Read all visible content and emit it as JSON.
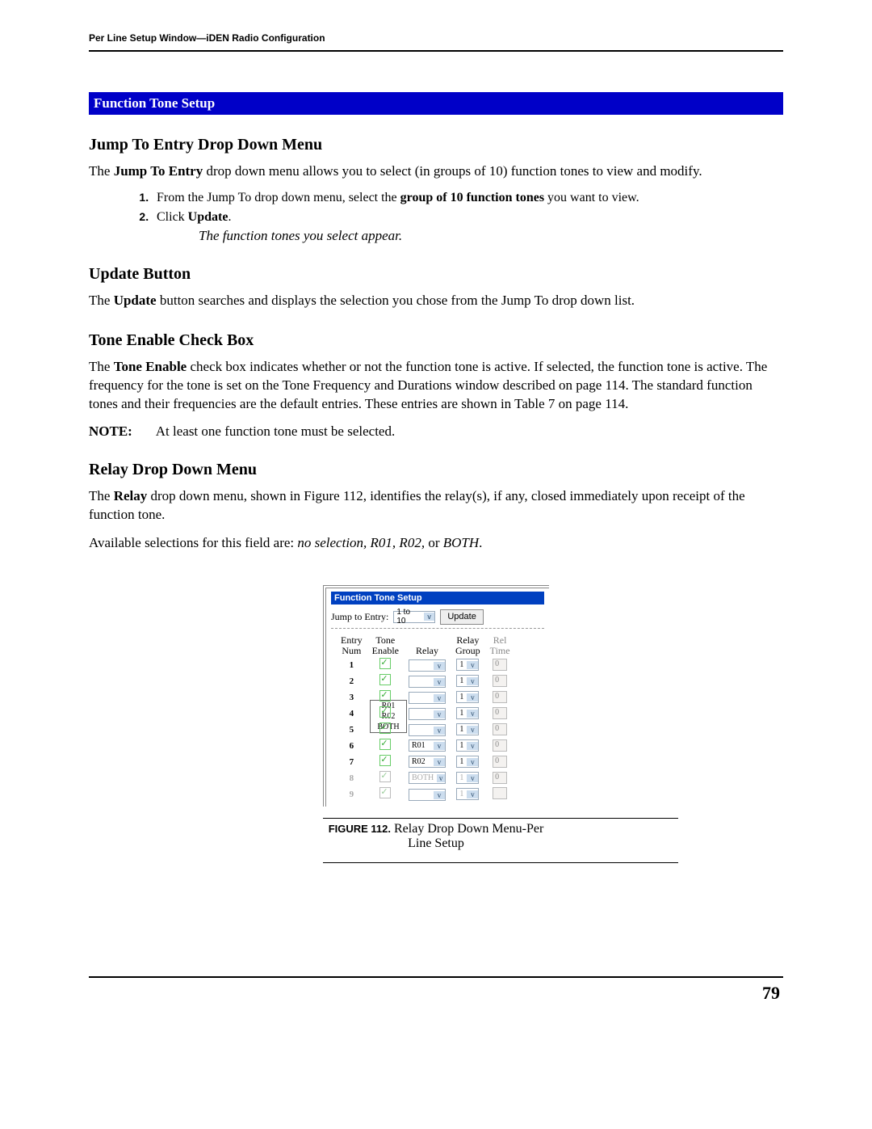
{
  "header": {
    "running": "Per Line Setup Window—iDEN Radio Configuration"
  },
  "section_bar": "Function Tone Setup",
  "jump": {
    "heading": "Jump To Entry Drop Down Menu",
    "intro_pre": "The ",
    "intro_bold": "Jump To Entry",
    "intro_post": " drop down menu allows you to select (in groups of 10) function tones to view and modify.",
    "step1_pre": "From the Jump To drop down menu, select the ",
    "step1_bold": "group of 10 function tones",
    "step1_post": " you want to view.",
    "step2_pre": "Click ",
    "step2_bold": "Update",
    "step2_post": ".",
    "step_result": "The function tones you select appear."
  },
  "update": {
    "heading": "Update Button",
    "p_pre": "The ",
    "p_bold": "Update",
    "p_post": " button searches and displays the selection you chose from the Jump To drop down list."
  },
  "tone": {
    "heading": "Tone Enable Check Box",
    "p_pre": "The ",
    "p_bold": "Tone Enable",
    "p_post": " check box indicates whether or not the function tone is active. If selected, the function tone is active. The frequency for the tone is set on the Tone Frequency and Durations window described on page 114. The standard function tones and their frequencies are the default entries. These entries are shown in Table 7 on page 114.",
    "note_label": "NOTE:",
    "note_text": "At least one function tone must be selected."
  },
  "relay": {
    "heading": "Relay Drop Down Menu",
    "p1_pre": "The ",
    "p1_bold": "Relay",
    "p1_post": " drop down menu, shown in Figure 112, identifies the relay(s), if any, closed immediately upon receipt of the function tone.",
    "p2_pre": "Available selections for this field are: ",
    "p2_italic": "no selection, R01, R02, ",
    "p2_mid": "or ",
    "p2_italic2": "BOTH",
    "p2_end": "."
  },
  "figure": {
    "bar": "Function Tone Setup",
    "jump_label": "Jump to Entry:",
    "jump_value": "1 to 10",
    "update_btn": "Update",
    "cols": {
      "entry_a": "Entry",
      "entry_b": "Num",
      "tone_a": "Tone",
      "tone_b": "Enable",
      "relay": "Relay",
      "group_a": "Relay",
      "group_b": "Group",
      "time_a": "Rel",
      "time_b": "Time"
    },
    "menu": {
      "blank": " ",
      "r01": "R01",
      "r02": "R02",
      "both": "BOTH"
    },
    "rows": [
      {
        "n": "1",
        "relay": "",
        "group": "1",
        "time": "0",
        "fade": false
      },
      {
        "n": "2",
        "relay": "",
        "group": "1",
        "time": "0",
        "fade": false,
        "open": true
      },
      {
        "n": "3",
        "relay": "",
        "group": "1",
        "time": "0",
        "fade": false
      },
      {
        "n": "4",
        "relay": "",
        "group": "1",
        "time": "0",
        "fade": false
      },
      {
        "n": "5",
        "relay": "",
        "group": "1",
        "time": "0",
        "fade": false
      },
      {
        "n": "6",
        "relay": "R01",
        "group": "1",
        "time": "0",
        "fade": false
      },
      {
        "n": "7",
        "relay": "R02",
        "group": "1",
        "time": "0",
        "fade": false
      },
      {
        "n": "8",
        "relay": "BOTH",
        "group": "1",
        "time": "0",
        "fade": true
      },
      {
        "n": "9",
        "relay": "",
        "group": "1",
        "time": "",
        "fade": true
      }
    ],
    "caption_label": "FIGURE 112.",
    "caption_text": "  Relay Drop Down Menu-Per Line Setup"
  },
  "page_number": "79"
}
